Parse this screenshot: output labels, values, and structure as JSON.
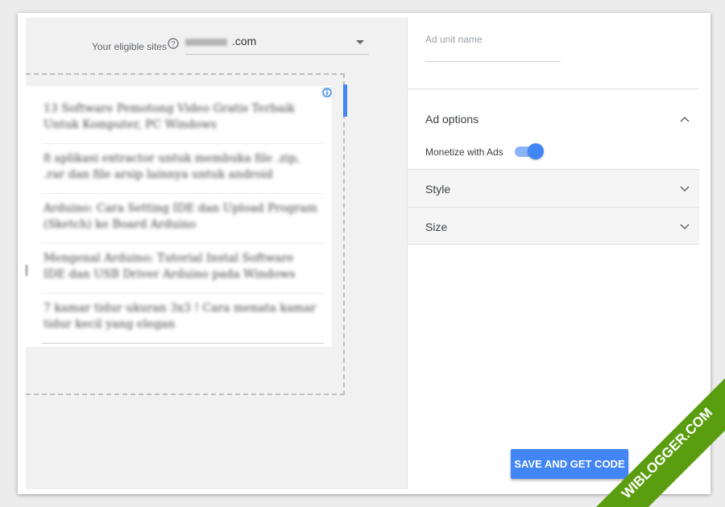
{
  "site_picker": {
    "label": "Your eligible sites",
    "value": ".com"
  },
  "preview": {
    "items": [
      "13 Software Pemotong Video Gratis Terbaik Untuk Komputer, PC Windows",
      "8 aplikasi extractor untuk membuka file .zip, .rar dan file arsip lainnya untuk android",
      "Arduino: Cara Setting IDE dan Upload Program (Sketch) ke Board Arduino",
      "Mengenal Arduino: Tutorial Instal Software IDE dan USB Driver Arduino pada Windows",
      "7 kamar tidur ukuran 3x3 ! Cara menata kamar tidur kecil yang elegan"
    ]
  },
  "panel": {
    "ad_unit_name_placeholder": "Ad unit name",
    "ad_options_title": "Ad options",
    "monetize_label": "Monetize with Ads",
    "monetize_on": true,
    "style_title": "Style",
    "size_title": "Size",
    "save_button": "SAVE AND GET CODE"
  },
  "watermark": {
    "text": "WIBLOGGER.COM"
  },
  "colors": {
    "accent": "#4285f4",
    "ribbon": "#5a9e0f"
  }
}
